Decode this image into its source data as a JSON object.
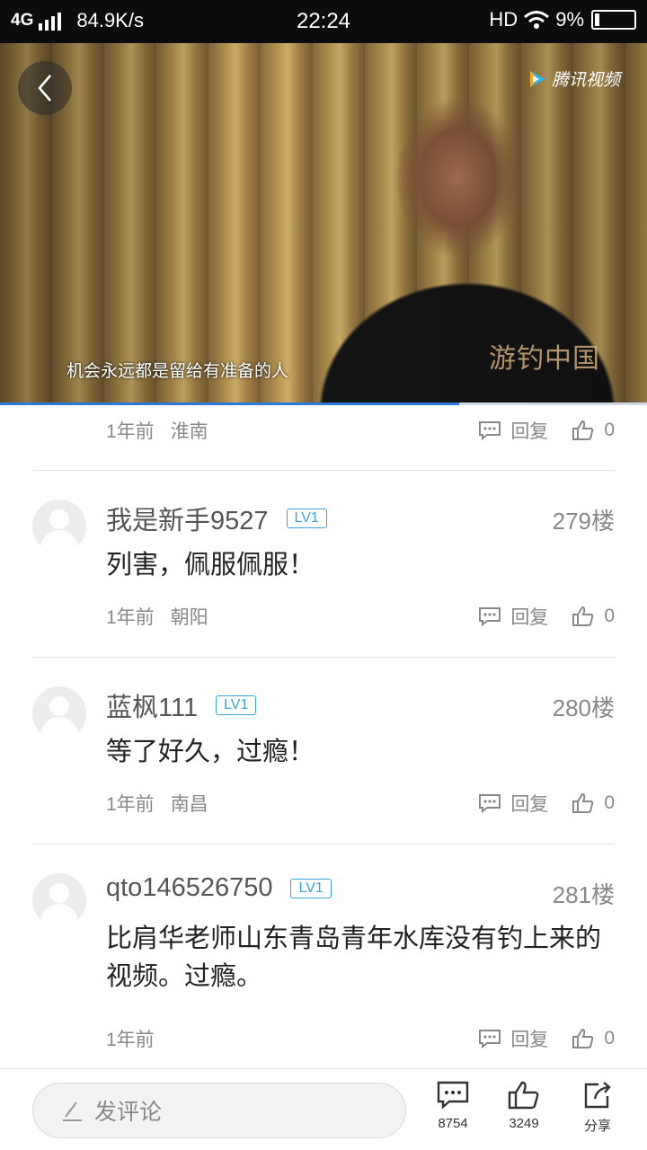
{
  "status_bar": {
    "network": "4G",
    "speed": "84.9K/s",
    "time": "22:24",
    "hd": "HD",
    "battery": "9%"
  },
  "video": {
    "brand": "腾讯视频",
    "watermark": "游钓中国",
    "subtitle": "机会永远都是留给有准备的人",
    "progress_fraction": 0.71
  },
  "comments": [
    {
      "time": "1年前",
      "location": "淮南",
      "reply_label": "回复",
      "likes": "0"
    },
    {
      "user": "我是新手9527",
      "level": "LV1",
      "floor": "279楼",
      "text": "列害，佩服佩服！",
      "time": "1年前",
      "location": "朝阳",
      "reply_label": "回复",
      "likes": "0"
    },
    {
      "user": "蓝枫111",
      "level": "LV1",
      "floor": "280楼",
      "text": "等了好久，过瘾！",
      "time": "1年前",
      "location": "南昌",
      "reply_label": "回复",
      "likes": "0"
    },
    {
      "user": "qto146526750",
      "level": "LV1",
      "floor": "281楼",
      "text": "比肩华老师山东青岛青年水库没有钓上来的视频。过瘾。",
      "time": "1年前",
      "location": "",
      "reply_label": "回复",
      "likes": "0"
    }
  ],
  "bottom_bar": {
    "comment_placeholder": "发评论",
    "comment_count": "8754",
    "like_count": "3249",
    "share_label": "分享"
  },
  "icons": {
    "back": "chevron-left-icon",
    "reply": "comment-bubble-icon",
    "like": "thumbs-up-icon",
    "share": "share-icon",
    "pencil": "pencil-icon",
    "wifi": "wifi-icon"
  },
  "colors": {
    "accent": "#2a7ad6",
    "level_badge": "#3aa3d8"
  }
}
